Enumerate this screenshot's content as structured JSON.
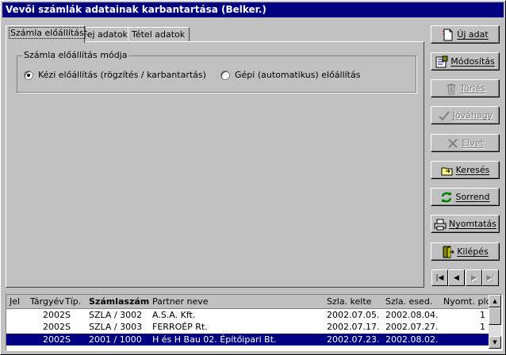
{
  "window": {
    "title": "Vevői számlák adatainak karbantartása (Belker.)"
  },
  "tabs": [
    {
      "label": "Számla előállítás",
      "active": true
    },
    {
      "label": "Fej adatok",
      "active": false
    },
    {
      "label": "Tétel adatok",
      "active": false
    }
  ],
  "group": {
    "legend": "Számla előállítás módja",
    "options": [
      {
        "label": "Kézi előállítás (rögzítés / karbantartás)",
        "checked": true
      },
      {
        "label": "Gépi (automatikus) előállítás",
        "checked": false
      }
    ]
  },
  "buttons": [
    {
      "label": "Új adat",
      "icon": "new-document-icon",
      "enabled": true
    },
    {
      "label": "Módosítás",
      "icon": "edit-icon",
      "enabled": true
    },
    {
      "label": "Törlés",
      "icon": "trash-icon",
      "enabled": false
    },
    {
      "label": "Jóváhagy",
      "icon": "checkmark-icon",
      "enabled": false
    },
    {
      "label": "Elvet",
      "icon": "cancel-x-icon",
      "enabled": false
    },
    {
      "label": "Keresés",
      "icon": "search-folder-icon",
      "enabled": true
    },
    {
      "label": "Sorrend",
      "icon": "refresh-arrows-icon",
      "enabled": true
    },
    {
      "label": "Nyomtatás",
      "icon": "printer-icon",
      "enabled": true
    },
    {
      "label": "Kilépés",
      "icon": "exit-door-icon",
      "enabled": true
    }
  ],
  "nav": [
    {
      "glyph": "|◀",
      "icon": "first-record-icon",
      "enabled": true
    },
    {
      "glyph": "◀",
      "icon": "previous-record-icon",
      "enabled": true
    },
    {
      "glyph": "▶",
      "icon": "next-record-icon",
      "enabled": false
    },
    {
      "glyph": "▶|",
      "icon": "last-record-icon",
      "enabled": false
    }
  ],
  "grid": {
    "columns": [
      "Jel",
      "Tárgyév",
      "Típ.",
      "Számlaszám",
      "Partner neve",
      "Szla. kelte",
      "Szla. esed.",
      "Nyomt. pld."
    ],
    "rows": [
      {
        "jel": "",
        "targyev": "2002",
        "tip": "S",
        "szamlaszam": "SZLA / 3002",
        "partner": "A.S.A. Kft.",
        "kelte": "2002.07.05.",
        "esed": "2002.08.04.",
        "pld": "1",
        "selected": false
      },
      {
        "jel": "",
        "targyev": "2002",
        "tip": "S",
        "szamlaszam": "SZLA / 3003",
        "partner": "FERROÉP Rt.",
        "kelte": "2002.07.17.",
        "esed": "2002.07.27.",
        "pld": "1",
        "selected": false
      },
      {
        "jel": "",
        "targyev": "2002",
        "tip": "S",
        "szamlaszam": "2001 / 1000",
        "partner": "H és H Bau 02. Építőipari Bt.",
        "kelte": "2002.07.23.",
        "esed": "2002.08.02.",
        "pld": "",
        "selected": true
      }
    ]
  },
  "colors": {
    "titlebar": "#000080",
    "face": "#c0c0c0",
    "selection": "#000080",
    "sync_icon": "#008000"
  }
}
